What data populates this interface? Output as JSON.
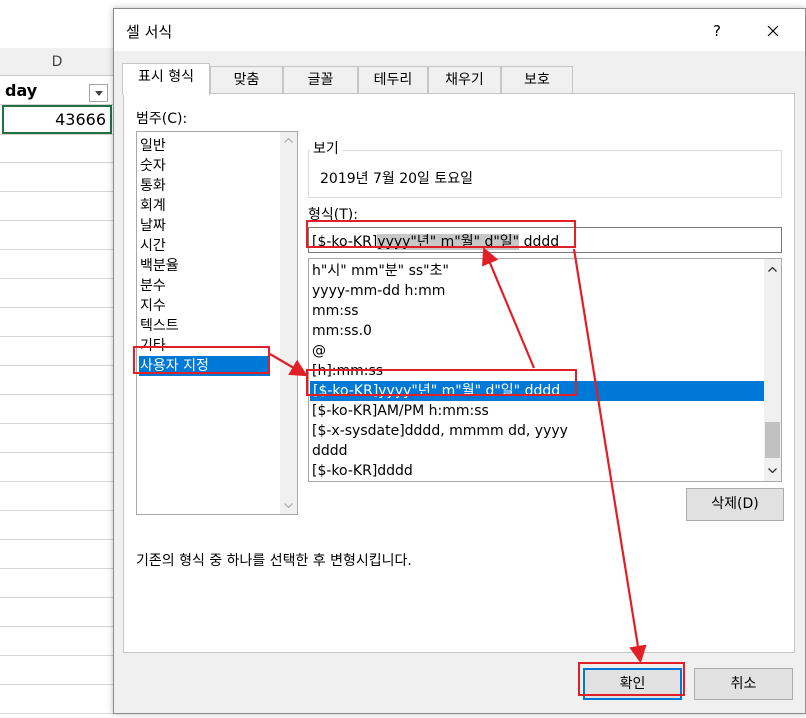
{
  "sheet": {
    "column_header": "D",
    "header_cell": "day",
    "value_cell": "43666"
  },
  "dialog": {
    "title": "셀 서식",
    "help_label": "?",
    "tabs": [
      "표시 형식",
      "맞춤",
      "글꼴",
      "테두리",
      "채우기",
      "보호"
    ],
    "category_label": "범주(C):",
    "categories": [
      "일반",
      "숫자",
      "통화",
      "회계",
      "날짜",
      "시간",
      "백분율",
      "분수",
      "지수",
      "텍스트",
      "기타",
      "사용자 지정"
    ],
    "selected_category": "사용자 지정",
    "sample_legend": "보기",
    "sample_value": "2019년 7월 20일 토요일",
    "type_label": "형식(T):",
    "type_input": {
      "prefix": "[$-ko-KR]",
      "highlighted": "yyyy\"년\" m\"월\" d\"일\"",
      "suffix": " dddd"
    },
    "formats": [
      "h\"시\" mm\"분\" ss\"초\"",
      "yyyy-mm-dd h:mm",
      "mm:ss",
      "mm:ss.0",
      "@",
      "[h]:mm:ss",
      "[$-ko-KR]yyyy\"년\" m\"월\" d\"일\" dddd",
      "[$-ko-KR]AM/PM h:mm:ss",
      "[$-x-sysdate]dddd, mmmm dd, yyyy",
      "dddd",
      "[$-ko-KR]dddd"
    ],
    "selected_format": "[$-ko-KR]yyyy\"년\" m\"월\" d\"일\" dddd",
    "delete_button": "삭제(D)",
    "description": "기존의 형식 중 하나를 선택한 후 변형시킵니다.",
    "ok_button": "확인",
    "cancel_button": "취소"
  },
  "colors": {
    "selection": "#0078d7",
    "annotation": "#e21e26",
    "cell_border": "#217346"
  }
}
